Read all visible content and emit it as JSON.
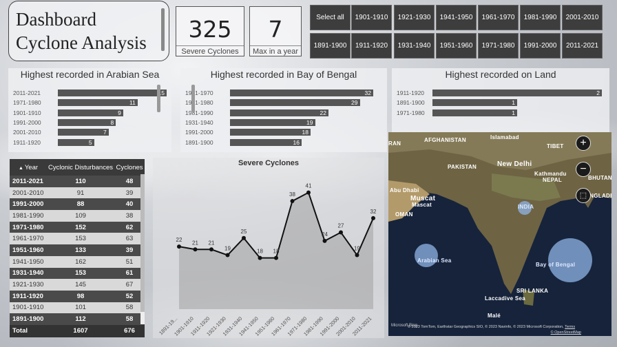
{
  "title": "Dashboard Cyclone Analysis",
  "title_line1": "Dashboard",
  "title_line2": "Cyclone Analysis",
  "kpis": [
    {
      "value": "325",
      "label": "Severe Cyclones"
    },
    {
      "value": "7",
      "label": "Max in a year"
    }
  ],
  "slicer": {
    "row1": [
      "Select all",
      "1901-1910",
      "1921-1930",
      "1941-1950",
      "1961-1970",
      "1981-1990",
      "2001-2010"
    ],
    "row2": [
      "1891-1900",
      "1911-1920",
      "1931-1940",
      "1951-1960",
      "1971-1980",
      "1991-2000",
      "2011-2021"
    ]
  },
  "bar_cards": [
    {
      "title": "Highest recorded in Arabian Sea",
      "rows": [
        [
          "2011-2021",
          15
        ],
        [
          "1971-1980",
          11
        ],
        [
          "1901-1910",
          9
        ],
        [
          "1991-2000",
          8
        ],
        [
          "2001-2010",
          7
        ],
        [
          "1911-1920",
          5
        ]
      ]
    },
    {
      "title": "Highest recorded in Bay of Bengal",
      "rows": [
        [
          "1961-1970",
          32
        ],
        [
          "1971-1980",
          29
        ],
        [
          "1981-1990",
          22
        ],
        [
          "1931-1940",
          19
        ],
        [
          "1991-2000",
          18
        ],
        [
          "1891-1900",
          16
        ]
      ]
    },
    {
      "title": "Highest recorded on Land",
      "rows": [
        [
          "1911-1920",
          2
        ],
        [
          "1891-1900",
          1
        ],
        [
          "1971-1980",
          1
        ]
      ]
    }
  ],
  "table": {
    "headers": [
      "Year",
      "Cyclonic Disturbances",
      "Cyclones"
    ],
    "rows": [
      [
        "2011-2021",
        "110",
        "48"
      ],
      [
        "2001-2010",
        "91",
        "39"
      ],
      [
        "1991-2000",
        "88",
        "40"
      ],
      [
        "1981-1990",
        "109",
        "38"
      ],
      [
        "1971-1980",
        "152",
        "62"
      ],
      [
        "1961-1970",
        "153",
        "63"
      ],
      [
        "1951-1960",
        "133",
        "39"
      ],
      [
        "1941-1950",
        "162",
        "51"
      ],
      [
        "1931-1940",
        "153",
        "61"
      ],
      [
        "1921-1930",
        "145",
        "67"
      ],
      [
        "1911-1920",
        "98",
        "52"
      ],
      [
        "1901-1910",
        "101",
        "58"
      ],
      [
        "1891-1900",
        "112",
        "58"
      ]
    ],
    "total": [
      "Total",
      "1607",
      "676"
    ]
  },
  "chart_data": {
    "type": "area",
    "title": "Severe Cyclones",
    "categories": [
      "1891-1900",
      "1901-1910",
      "1911-1920",
      "1921-1930",
      "1931-1940",
      "1941-1950",
      "1951-1960",
      "1961-1970",
      "1971-1980",
      "1981-1990",
      "1991-2000",
      "2001-2010",
      "2011-2021"
    ],
    "tick_labels": [
      "1891-19...",
      "1901-1910",
      "1911-1920",
      "1921-1930",
      "1931-1940",
      "1941-1950",
      "1951-1960",
      "1961-1970",
      "1971-1980",
      "1981-1990",
      "1991-2000",
      "2001-2010",
      "2011-2021"
    ],
    "values": [
      22,
      21,
      21,
      19,
      25,
      18,
      18,
      38,
      41,
      24,
      27,
      19,
      32
    ],
    "ylim": [
      0,
      45
    ]
  },
  "map": {
    "labels": [
      "AFGHANISTAN",
      "Islamabad",
      "TIBET",
      "PAKISTAN",
      "New Delhi",
      "NEPAL",
      "Kathmandu",
      "BHUTAN",
      "Abu Dhabi",
      "Muscat",
      "Mascat",
      "OMAN",
      "BANGLADESH",
      "INDIA",
      "Arabian Sea",
      "Bay of Bengal",
      "SRI LANKA",
      "Laccadive Sea",
      "Malé",
      "RAN"
    ],
    "copyright": "© 2023 TomTom, Earthstar Geographics SIO, © 2023 Navinfo, © 2023 Microsoft Corporation,",
    "terms": "Terms",
    "osm": "© OpenStreetMap",
    "bing": "Microsoft Bing",
    "zoom_in": "+",
    "zoom_out": "−"
  },
  "colors": {
    "dark": "#3d3d3d",
    "bar": "#555555",
    "bubble": "#8fb4e6"
  }
}
